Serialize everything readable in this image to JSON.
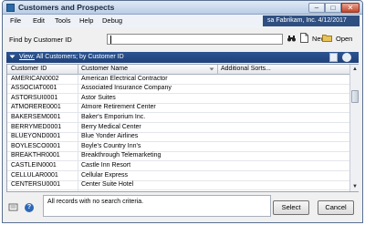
{
  "window": {
    "title": "Customers and Prospects"
  },
  "menu": {
    "items": [
      "File",
      "Edit",
      "Tools",
      "Help",
      "Debug"
    ]
  },
  "company_bar": "sa  Fabrikam, Inc.  4/12/2017",
  "find": {
    "label": "Find by Customer ID",
    "value": ""
  },
  "toolbar": {
    "new_label": "New",
    "open_label": "Open"
  },
  "view": {
    "prefix": "View:",
    "text": "All Customers; by Customer ID"
  },
  "grid": {
    "columns": [
      "Customer ID",
      "Customer Name",
      "Additional Sorts..."
    ],
    "rows": [
      {
        "id": "AMERICAN0002",
        "name": "American Electrical Contractor"
      },
      {
        "id": "ASSOCIAT0001",
        "name": "Associated Insurance Company"
      },
      {
        "id": "ASTORSUI0001",
        "name": "Astor Suites"
      },
      {
        "id": "ATMORERE0001",
        "name": "Atmore Retirement Center"
      },
      {
        "id": "BAKERSEM0001",
        "name": "Baker's Emporium Inc."
      },
      {
        "id": "BERRYMED0001",
        "name": "Berry Medical Center"
      },
      {
        "id": "BLUEYOND0001",
        "name": "Blue Yonder Airlines"
      },
      {
        "id": "BOYLESCO0001",
        "name": "Boyle's Country Inn's"
      },
      {
        "id": "BREAKTHR0001",
        "name": "Breakthrough Telemarketing"
      },
      {
        "id": "CASTLEIN0001",
        "name": "Castle Inn Resort"
      },
      {
        "id": "CELLULAR0001",
        "name": "Cellular Express"
      },
      {
        "id": "CENTERSU0001",
        "name": "Center Suite Hotel"
      }
    ]
  },
  "status": {
    "text": "All records with no search criteria."
  },
  "buttons": {
    "select": "Select",
    "cancel": "Cancel"
  },
  "colors": {
    "viewbar": "#2c5591",
    "company_bar": "#2f4f80"
  }
}
